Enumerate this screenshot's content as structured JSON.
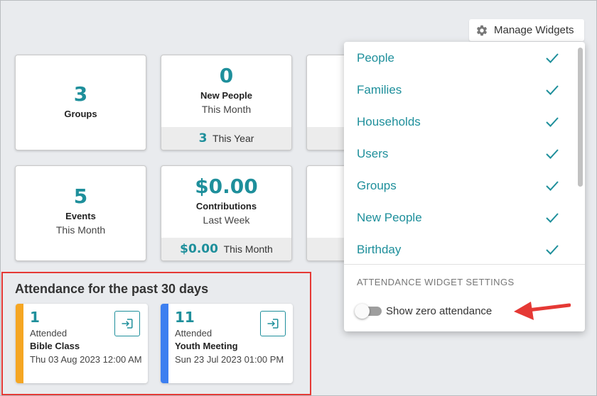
{
  "header": {
    "manage_widgets_label": "Manage Widgets"
  },
  "widgets": {
    "groups": {
      "value": "3",
      "label": "Groups"
    },
    "new_people": {
      "value": "0",
      "label": "New People",
      "sub": "This Month",
      "footer_value": "3",
      "footer_label": "This Year"
    },
    "events": {
      "value": "5",
      "label": "Events",
      "sub": "This Month"
    },
    "contributions": {
      "value": "$0.00",
      "label": "Contributions",
      "sub": "Last Week",
      "footer_value": "$0.00",
      "footer_label": "This Month"
    }
  },
  "menu": {
    "items": [
      {
        "label": "People",
        "checked": true
      },
      {
        "label": "Families",
        "checked": true
      },
      {
        "label": "Households",
        "checked": true
      },
      {
        "label": "Users",
        "checked": true
      },
      {
        "label": "Groups",
        "checked": true
      },
      {
        "label": "New People",
        "checked": true
      },
      {
        "label": "Birthday",
        "checked": true
      }
    ],
    "settings_title": "ATTENDANCE WIDGET SETTINGS",
    "toggle_label": "Show zero attendance",
    "toggle_on": false
  },
  "attendance": {
    "title": "Attendance for the past 30 days",
    "cards": [
      {
        "count": "1",
        "label": "Attended",
        "group": "Bible Class",
        "date": "Thu 03 Aug 2023 12:00 AM",
        "color": "#f5a623"
      },
      {
        "count": "11",
        "label": "Attended",
        "group": "Youth Meeting",
        "date": "Sun 23 Jul 2023 01:00 PM",
        "color": "#3d7ff0"
      }
    ]
  },
  "colors": {
    "accent": "#1e8f9b",
    "highlight": "#e53935"
  },
  "icons": {
    "manage": "gear-icon",
    "check": "check-icon",
    "open_attendance": "login-arrow-icon"
  }
}
